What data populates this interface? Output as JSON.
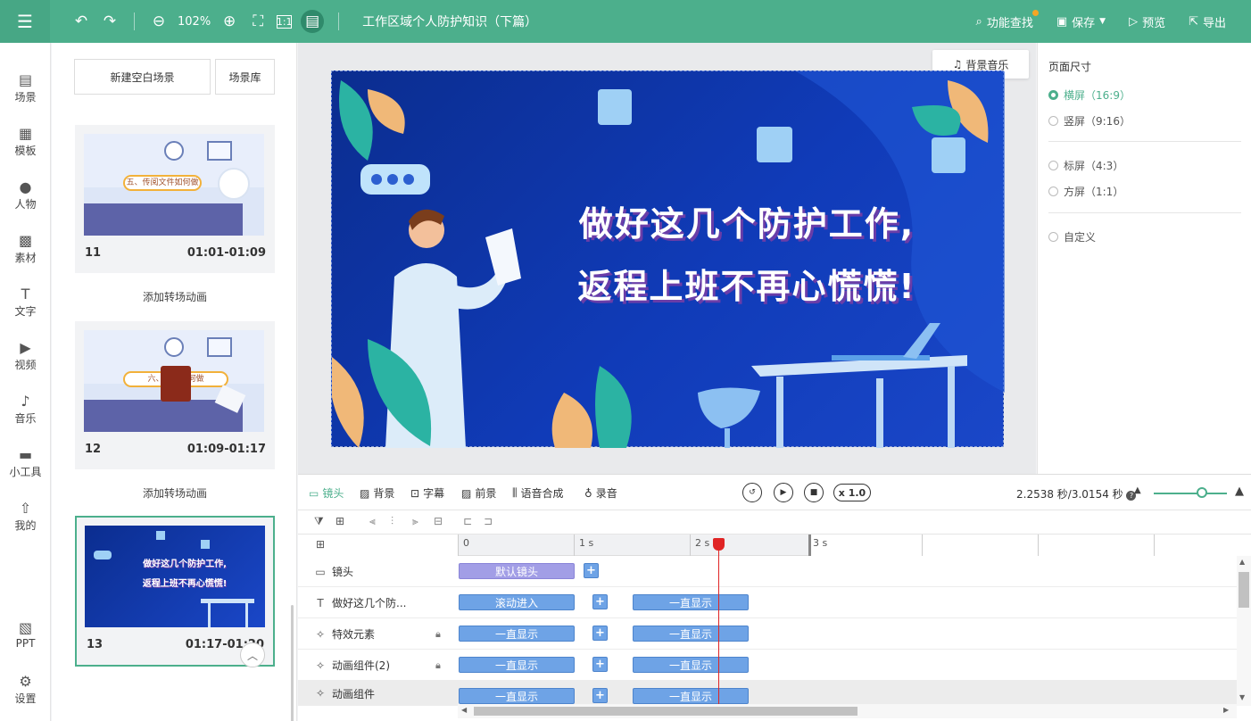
{
  "topbar": {
    "zoom": "102%",
    "title": "工作区域个人防护知识（下篇）",
    "actions": {
      "find": "功能查找",
      "save": "保存",
      "preview": "预览",
      "export": "导出"
    }
  },
  "sidebar": {
    "items": [
      {
        "label": "场景",
        "icon": "scene-icon"
      },
      {
        "label": "模板",
        "icon": "template-icon"
      },
      {
        "label": "人物",
        "icon": "person-icon"
      },
      {
        "label": "素材",
        "icon": "material-icon"
      },
      {
        "label": "文字",
        "icon": "text-icon"
      },
      {
        "label": "视频",
        "icon": "video-icon"
      },
      {
        "label": "音乐",
        "icon": "music-icon"
      },
      {
        "label": "小工具",
        "icon": "toolbox-icon"
      },
      {
        "label": "我的",
        "icon": "upload-icon"
      },
      {
        "label": "PPT",
        "icon": "ppt-icon"
      },
      {
        "label": "设置",
        "icon": "gear-icon"
      }
    ]
  },
  "scenes": {
    "new_blank": "新建空白场景",
    "library": "场景库",
    "transition_label": "添加转场动画",
    "cards": [
      {
        "num": "11",
        "time": "01:01-01:09",
        "banner": "五、传阅文件如何做"
      },
      {
        "num": "12",
        "time": "01:09-01:17",
        "banner": "六、电话如何做"
      },
      {
        "num": "13",
        "time": "01:17-01:20",
        "line1": "做好这几个防护工作,",
        "line2": "返程上班不再心慌慌!"
      }
    ]
  },
  "canvas": {
    "bg_music": "背景音乐",
    "line1": "做好这几个防护工作,",
    "line2": "返程上班不再心慌慌!"
  },
  "page_size": {
    "title": "页面尺寸",
    "options": [
      {
        "label": "横屏（16:9）",
        "selected": true
      },
      {
        "label": "竖屏（9:16）",
        "selected": false
      },
      {
        "label": "标屏（4:3）",
        "selected": false
      },
      {
        "label": "方屏（1:1）",
        "selected": false
      },
      {
        "label": "自定义",
        "selected": false
      }
    ]
  },
  "timeline": {
    "tabs": [
      "镜头",
      "背景",
      "字幕",
      "前景",
      "语音合成",
      "录音"
    ],
    "speed": "x 1.0",
    "time_info": "2.2538 秒/3.0154 秒",
    "ruler": [
      "0",
      "1 s",
      "2 s",
      "3 s"
    ],
    "playhead_seconds": 2.2538,
    "total_seconds": 3.0154,
    "tracks": [
      {
        "label": "镜头",
        "icon": "camera-icon",
        "clips": [
          "默认镜头"
        ]
      },
      {
        "label": "做好这几个防...",
        "icon": "text-box-icon",
        "clips": [
          "滚动进入",
          "一直显示"
        ]
      },
      {
        "label": "特效元素",
        "icon": "star-icon",
        "locked": true,
        "clips": [
          "一直显示",
          "一直显示"
        ]
      },
      {
        "label": "动画组件(2)",
        "icon": "star-icon",
        "locked": true,
        "clips": [
          "一直显示",
          "一直显示"
        ]
      },
      {
        "label": "动画组件",
        "icon": "star-icon",
        "clips": [
          "一直显示",
          "一直显示"
        ]
      }
    ]
  },
  "colors": {
    "accent": "#4caf8c",
    "slide_bg": "#1237b0",
    "clip": "#6ea3e6",
    "playhead": "#e02424"
  }
}
